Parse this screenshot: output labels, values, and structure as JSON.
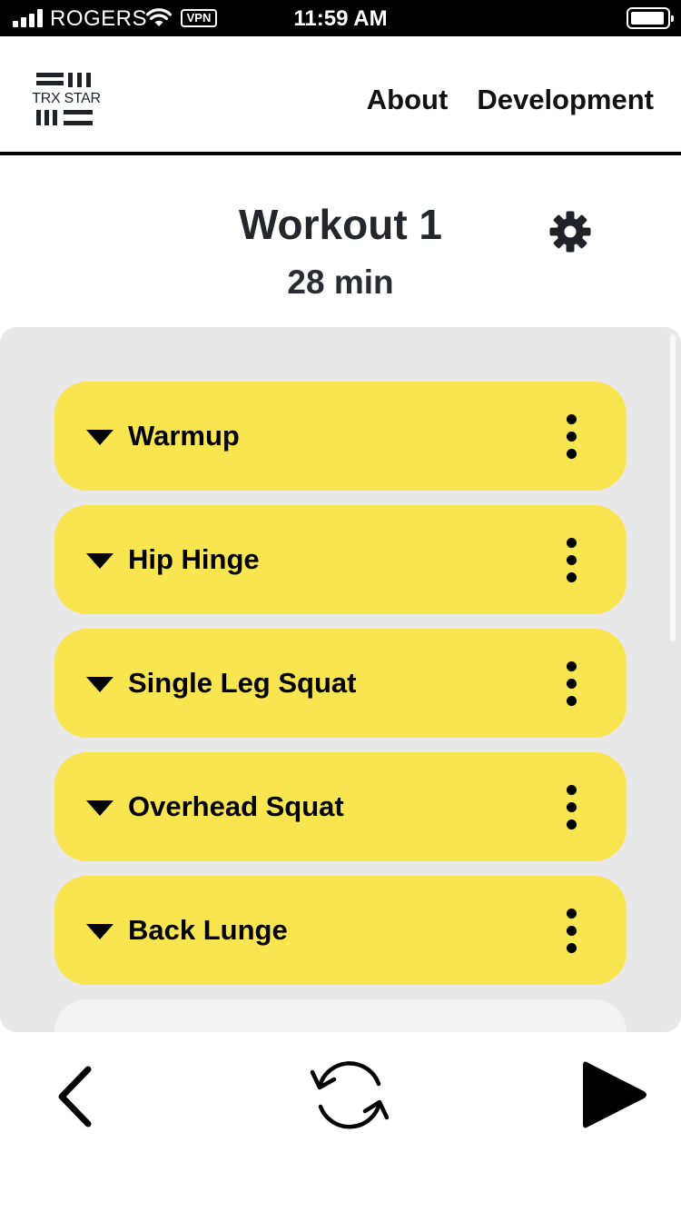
{
  "status_bar": {
    "carrier": "ROGERS",
    "vpn": "VPN",
    "time": "11:59 AM",
    "icons": [
      "signal-icon",
      "wifi-icon",
      "vpn-icon",
      "battery-icon"
    ]
  },
  "header": {
    "logo_text": "TRX STAR",
    "nav": {
      "about": "About",
      "development": "Development"
    }
  },
  "workout": {
    "title": "Workout 1",
    "duration": "28 min"
  },
  "exercises": [
    {
      "label": "Warmup"
    },
    {
      "label": "Hip Hinge"
    },
    {
      "label": "Single Leg Squat"
    },
    {
      "label": "Overhead Squat"
    },
    {
      "label": "Back Lunge"
    }
  ],
  "toolbar": {
    "icons": [
      "back-chevron-icon",
      "refresh-icon",
      "play-icon"
    ]
  },
  "colors": {
    "accent": "#f8e54f",
    "panel": "#e8e8e8",
    "text": "#1f2228"
  }
}
